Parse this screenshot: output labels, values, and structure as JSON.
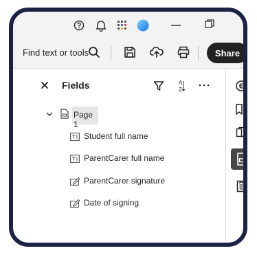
{
  "window": {
    "help_icon": "help-circle-icon",
    "notification_icon": "bell-icon",
    "apps_icon": "apps-grid-icon",
    "profile_icon": "profile-avatar-icon",
    "minimize_icon": "minimize-icon",
    "restore_icon": "restore-icon"
  },
  "toolbar": {
    "find_label": "Find text or tools",
    "share_label": "Share",
    "accent_color": "#1c2244"
  },
  "panel": {
    "title": "Fields",
    "sort_icon_label": "A Z"
  },
  "tree": {
    "page_label": "Page 1",
    "fields": [
      {
        "label": "Student full name",
        "type": "text-field-icon"
      },
      {
        "label": "ParentCarer full name",
        "type": "text-field-icon"
      },
      {
        "label": "ParentCarer signature",
        "type": "signature-field-icon"
      },
      {
        "label": "Date of signing",
        "type": "signature-field-icon"
      }
    ]
  },
  "rail": {
    "items": [
      "comment-icon",
      "bookmark-list-icon",
      "pages-icon",
      "form-fields-icon",
      "document-icon"
    ],
    "active": "form-fields-icon"
  }
}
